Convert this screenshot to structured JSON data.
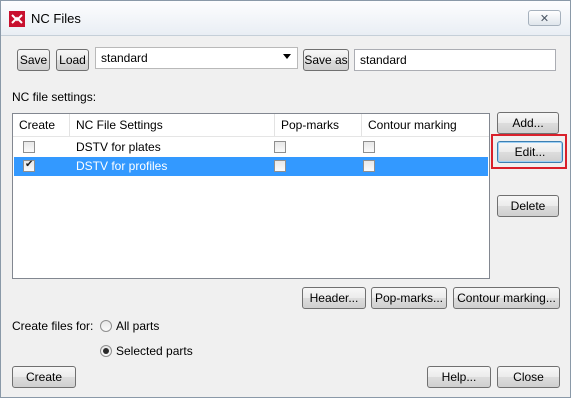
{
  "window": {
    "title": "NC Files"
  },
  "toolbar": {
    "save_label": "Save",
    "load_label": "Load",
    "preset_value": "standard",
    "save_as_label": "Save as",
    "save_as_value": "standard"
  },
  "settings_label": "NC file settings:",
  "table": {
    "headers": [
      "Create",
      "NC File Settings",
      "Pop-marks",
      "Contour marking"
    ],
    "rows": [
      {
        "create": false,
        "name": "DSTV for plates",
        "pop_marks": false,
        "contour": false,
        "selected": false
      },
      {
        "create": true,
        "name": "DSTV for profiles",
        "pop_marks": false,
        "contour": false,
        "selected": true
      }
    ]
  },
  "side_buttons": {
    "add": "Add...",
    "edit": "Edit...",
    "delete": "Delete"
  },
  "bottom_buttons": {
    "header": "Header...",
    "pop_marks": "Pop-marks...",
    "contour": "Contour marking..."
  },
  "create_for": {
    "label": "Create files for:",
    "options": [
      "All parts",
      "Selected parts"
    ],
    "selected": "Selected parts"
  },
  "footer": {
    "create": "Create",
    "help": "Help...",
    "close": "Close"
  },
  "colors": {
    "selection": "#3399ff",
    "highlight_box": "#d9202b"
  }
}
